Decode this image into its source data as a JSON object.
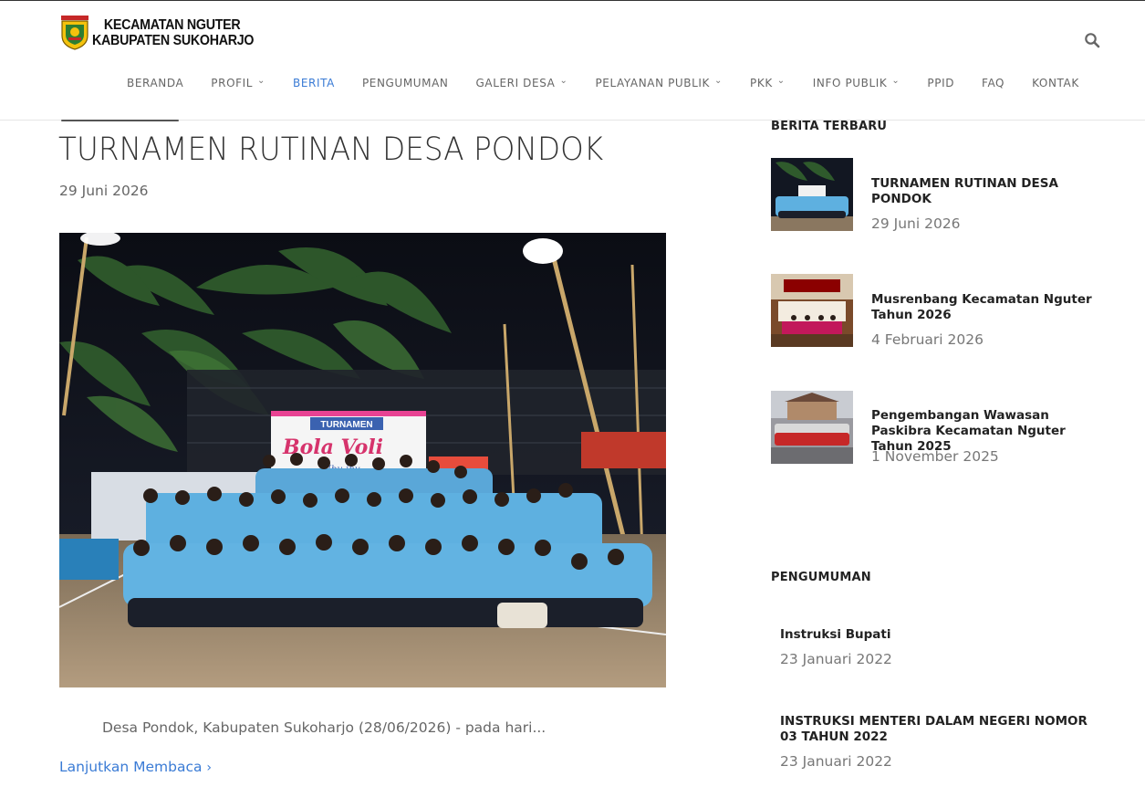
{
  "site": {
    "name_line1": "KECAMATAN NGUTER",
    "name_line2": "KABUPATEN SUKOHARJO",
    "logo_icon": "emblem-icon",
    "search_icon": "search-icon"
  },
  "nav": {
    "items": [
      {
        "label": "BERANDA",
        "dropdown": false,
        "active": false
      },
      {
        "label": "PROFIL",
        "dropdown": true,
        "active": false
      },
      {
        "label": "BERITA",
        "dropdown": false,
        "active": true
      },
      {
        "label": "PENGUMUMAN",
        "dropdown": false,
        "active": false
      },
      {
        "label": "GALERI DESA",
        "dropdown": true,
        "active": false
      },
      {
        "label": "PELAYANAN PUBLIK",
        "dropdown": true,
        "active": false
      },
      {
        "label": "PKK",
        "dropdown": true,
        "active": false
      },
      {
        "label": "INFO PUBLIK",
        "dropdown": true,
        "active": false
      },
      {
        "label": "PPID",
        "dropdown": false,
        "active": false
      },
      {
        "label": "FAQ",
        "dropdown": false,
        "active": false
      },
      {
        "label": "KONTAK",
        "dropdown": false,
        "active": false
      }
    ]
  },
  "post": {
    "title": "TURNAMEN RUTINAN DESA PONDOK",
    "date": "29 Juni 2026",
    "image_banner_title": "TURNAMEN",
    "image_banner_main": "Bola Voli",
    "image_banner_sub": "Ibu-ibu",
    "excerpt": "Desa Pondok, Kabupaten Sukoharjo (28/06/2026) - pada hari...",
    "read_more": "Lanjutkan Membaca"
  },
  "sidebar": {
    "latest_title": "BERITA TERBARU",
    "latest": [
      {
        "title": "TURNAMEN RUTINAN DESA PONDOK",
        "date": "29 Juni 2026"
      },
      {
        "title": "Musrenbang Kecamatan Nguter Tahun 2026",
        "date": "4 Februari 2026"
      },
      {
        "title": "Pengembangan Wawasan Paskibra Kecamatan Nguter Tahun 2025",
        "date": "1 November 2025"
      }
    ],
    "announcements_title": "PENGUMUMAN",
    "announcements": [
      {
        "title": "Instruksi Bupati",
        "date": "23 Januari 2022"
      },
      {
        "title": "INSTRUKSI MENTERI DALAM NEGERI NOMOR 03 TAHUN 2022",
        "date": "23 Januari 2022"
      }
    ]
  },
  "colors": {
    "accent": "#3a7bd5",
    "text_dark": "#222222",
    "text_muted": "#777777"
  }
}
